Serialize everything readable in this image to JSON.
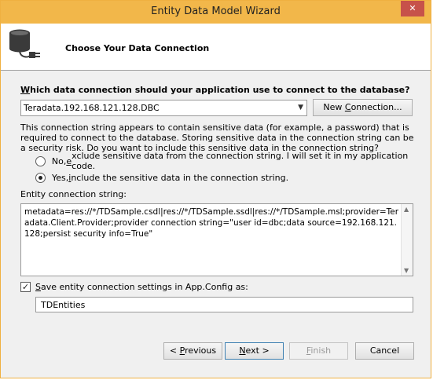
{
  "window": {
    "title": "Entity Data Model Wizard",
    "close_glyph": "✕"
  },
  "header": {
    "title": "Choose Your Data Connection",
    "icon": "database-plug-icon"
  },
  "question": {
    "prefix": "W",
    "rest": "hich data connection should your application use to connect to the database?"
  },
  "connection": {
    "selected": "Teradata.192.168.121.128.DBC"
  },
  "new_connection_button": {
    "prefix": "New ",
    "acc": "C",
    "rest": "onnection..."
  },
  "info_text": "This connection string appears to contain sensitive data (for example, a password) that is required to connect to the database. Storing sensitive data in the connection string can be a security risk. Do you want to include this sensitive data in the connection string?",
  "radio_no": {
    "prefix": "No, ",
    "acc": "e",
    "rest": "xclude sensitive data from the connection string. I will set it in my application code.",
    "checked": false
  },
  "radio_yes": {
    "prefix": "Yes, ",
    "acc": "i",
    "rest": "nclude the sensitive data in the connection string.",
    "checked": true
  },
  "entity_connection": {
    "label": "Entity connection string:",
    "value": "metadata=res://*/TDSample.csdl|res://*/TDSample.ssdl|res://*/TDSample.msl;provider=Teradata.Client.Provider;provider connection string=\"user id=dbc;data source=192.168.121.128;persist security info=True\""
  },
  "save_setting": {
    "prefix": "",
    "acc": "S",
    "rest": "ave entity connection settings in App.Config as:",
    "checked": true
  },
  "config_name": "TDEntities",
  "buttons": {
    "previous": {
      "prefix": "< ",
      "acc": "P",
      "rest": "revious"
    },
    "next": {
      "prefix": "",
      "acc": "N",
      "rest": "ext >"
    },
    "finish": {
      "prefix": "",
      "acc": "F",
      "rest": "inish"
    },
    "cancel": "Cancel"
  }
}
